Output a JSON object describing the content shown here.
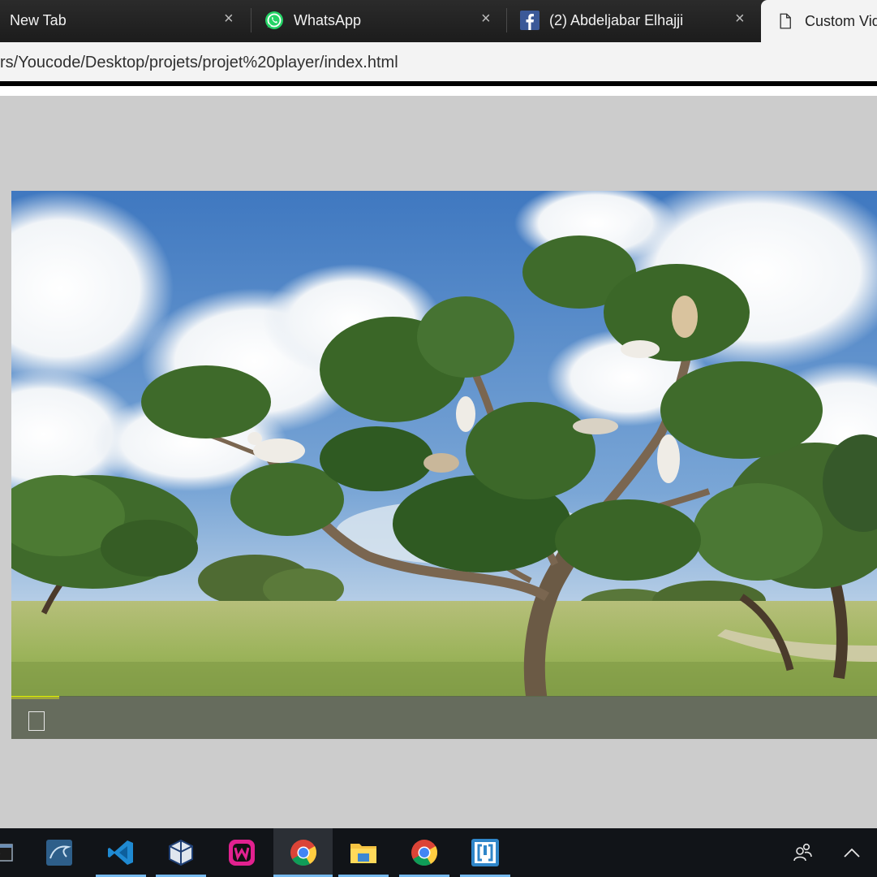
{
  "browser": {
    "tabs": [
      {
        "label": "New Tab",
        "icon": "blank-icon"
      },
      {
        "label": "WhatsApp",
        "icon": "whatsapp-icon"
      },
      {
        "label": "(2) Abdeljabar Elhajji",
        "icon": "facebook-icon"
      },
      {
        "label": "Custom Vid",
        "icon": "document-icon"
      }
    ],
    "close_glyph": "×",
    "address": "rs/Youcode/Desktop/projets/projet%20player/index.html"
  },
  "player": {
    "progress_fraction": 0.055,
    "progress_color": "#ddee00",
    "playing": false
  },
  "taskbar": {
    "items": [
      {
        "name": "terminal-icon",
        "active": false,
        "underline": false
      },
      {
        "name": "mysql-workbench-icon",
        "active": false,
        "underline": false
      },
      {
        "name": "vscode-icon",
        "active": false,
        "underline": true
      },
      {
        "name": "virtualbox-icon",
        "active": false,
        "underline": true
      },
      {
        "name": "wampserver-icon",
        "active": false,
        "underline": false
      },
      {
        "name": "chrome-icon",
        "active": true,
        "underline": true
      },
      {
        "name": "file-explorer-icon",
        "active": false,
        "underline": true
      },
      {
        "name": "chrome-icon",
        "active": false,
        "underline": true
      },
      {
        "name": "brackets-icon",
        "active": false,
        "underline": true
      }
    ],
    "tray": [
      "people-icon",
      "chevron-up-icon"
    ]
  }
}
